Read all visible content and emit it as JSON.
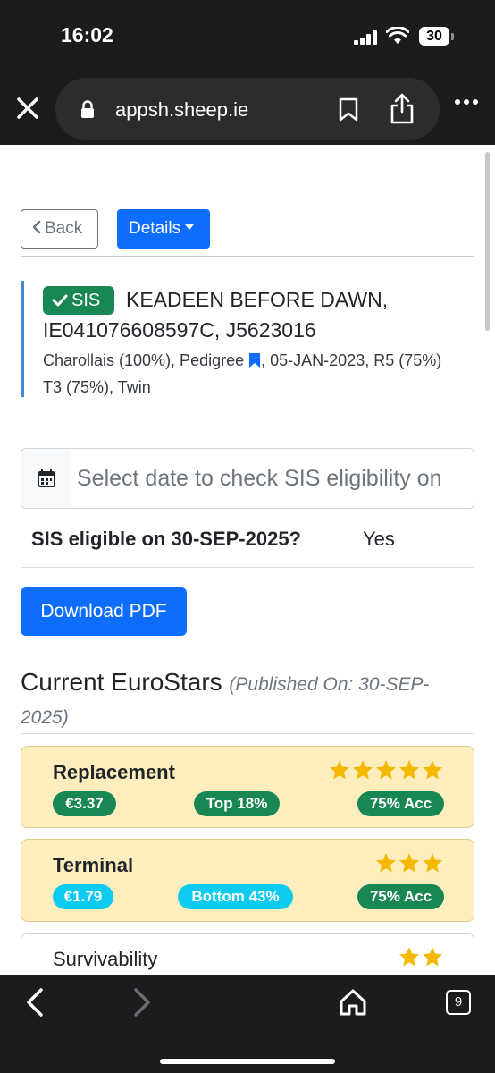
{
  "status_bar": {
    "time": "16:02",
    "battery": "30"
  },
  "browser": {
    "url": "appsh.sheep.ie"
  },
  "nav": {
    "back_label": "Back",
    "details_label": "Details"
  },
  "animal": {
    "sis_badge": "SIS",
    "name": "KEADEEN BEFORE DAWN, IE041076608597C, J5623016",
    "meta_before": "Charollais (100%), Pedigree",
    "meta_after": ", 05-JAN-2023, R5 (75%) T3 (75%), Twin"
  },
  "sis_check": {
    "placeholder": "Select date to check SIS eligibility on",
    "question": "SIS eligible on 30-SEP-2025?",
    "answer": "Yes"
  },
  "actions": {
    "download_pdf": "Download PDF"
  },
  "eurostars": {
    "title": "Current EuroStars",
    "published": "(Published On: 30-SEP-2025)",
    "cards": [
      {
        "title": "Replacement",
        "stars": 5,
        "value": "€3.37",
        "rank": "Top 18%",
        "accuracy": "75% Acc"
      },
      {
        "title": "Terminal",
        "stars": 3,
        "value": "€1.79",
        "rank": "Bottom 43%",
        "accuracy": "75% Acc"
      },
      {
        "title": "Survivability",
        "stars": 2
      }
    ]
  },
  "toolbar": {
    "tab_count": "9"
  },
  "colors": {
    "primary": "#0d6efd",
    "success": "#198754",
    "info": "#0dcaf0",
    "card_bg": "#feeebd",
    "star": "#f5b800"
  }
}
